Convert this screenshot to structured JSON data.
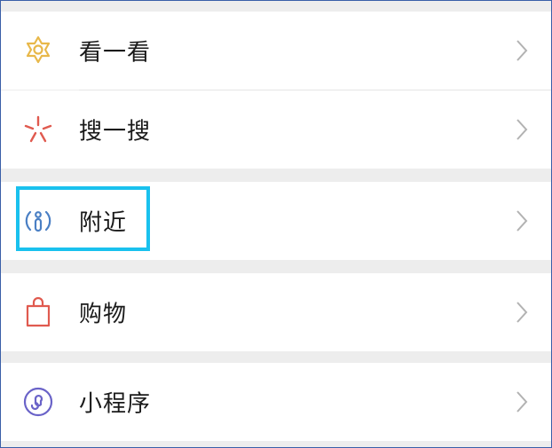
{
  "menu": {
    "items": [
      {
        "label": "看一看",
        "icon": "kanyikan-icon",
        "icon_color": "#e8b84a"
      },
      {
        "label": "搜一搜",
        "icon": "souyisou-icon",
        "icon_color": "#e05a4f"
      },
      {
        "label": "附近",
        "icon": "nearby-icon",
        "icon_color": "#4a7fc4"
      },
      {
        "label": "购物",
        "icon": "shopping-bag-icon",
        "icon_color": "#e05a4f"
      },
      {
        "label": "小程序",
        "icon": "mini-program-icon",
        "icon_color": "#6a63c8"
      }
    ],
    "highlight_color": "#19c1ee"
  }
}
